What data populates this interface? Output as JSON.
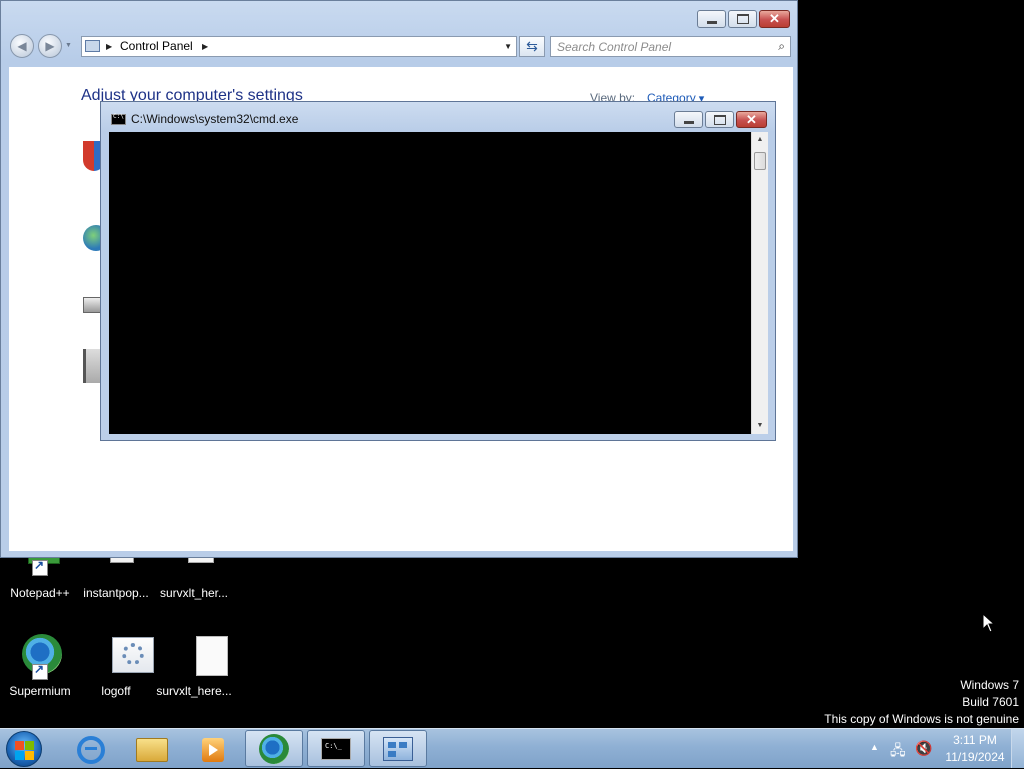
{
  "desktop": {
    "icons_row1": [
      {
        "label": "Notepad++",
        "icon": "notepad-plus-plus-icon"
      },
      {
        "label": "instantpop...",
        "icon": "file-icon"
      },
      {
        "label": "survxlt_her...",
        "icon": "file-icon"
      }
    ],
    "icons_row2": [
      {
        "label": "Supermium",
        "icon": "supermium-browser-icon"
      },
      {
        "label": "logoff",
        "icon": "settings-gear-file-icon"
      },
      {
        "label": "survxlt_here...",
        "icon": "blank-file-icon"
      }
    ],
    "watermark": {
      "line1": "Windows 7",
      "line2": "Build 7601",
      "line3": "This copy of Windows is not genuine"
    }
  },
  "control_panel": {
    "breadcrumb": "Control Panel",
    "search_placeholder": "Search Control Panel",
    "heading": "Adjust your computer's settings",
    "view_by_label": "View by:",
    "view_by_value": "Category"
  },
  "cmd": {
    "title": "C:\\Windows\\system32\\cmd.exe"
  },
  "taskbar": {
    "pinned": [
      "internet-explorer-icon",
      "windows-explorer-icon",
      "media-player-icon"
    ],
    "running": [
      "supermium-browser-icon",
      "cmd-icon",
      "control-panel-icon"
    ],
    "clock_time": "3:11 PM",
    "clock_date": "11/19/2024"
  }
}
